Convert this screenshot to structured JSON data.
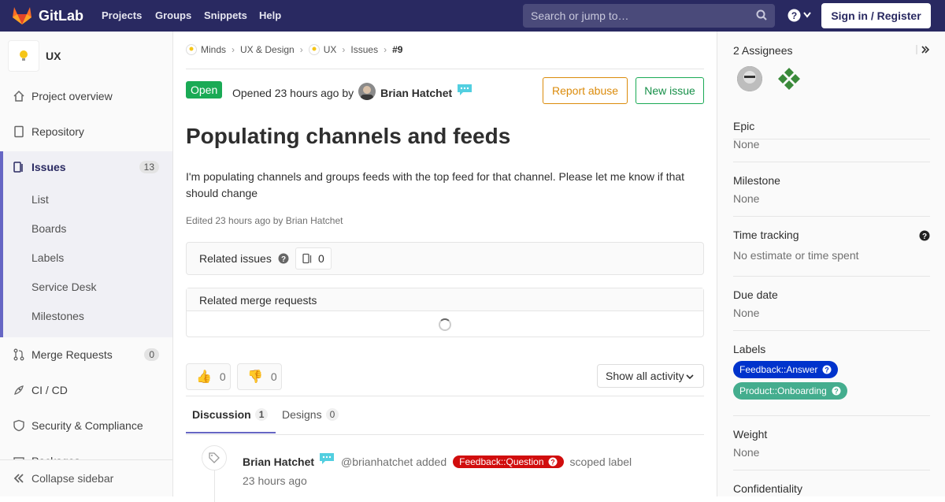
{
  "topbar": {
    "brand": "GitLab",
    "nav": [
      "Projects",
      "Groups",
      "Snippets",
      "Help"
    ],
    "search_placeholder": "Search or jump to…",
    "signin": "Sign in / Register"
  },
  "sidebar": {
    "project_name": "UX",
    "items": [
      {
        "label": "Project overview",
        "icon": "home-icon"
      },
      {
        "label": "Repository",
        "icon": "doc-icon"
      },
      {
        "label": "Issues",
        "icon": "issues-icon",
        "count": "13"
      },
      {
        "label": "Merge Requests",
        "icon": "merge-request-icon",
        "count": "0"
      },
      {
        "label": "CI / CD",
        "icon": "rocket-icon"
      },
      {
        "label": "Security & Compliance",
        "icon": "shield-icon"
      },
      {
        "label": "Packages",
        "icon": "package-icon"
      }
    ],
    "sub_items": [
      "List",
      "Boards",
      "Labels",
      "Service Desk",
      "Milestones"
    ],
    "collapse": "Collapse sidebar"
  },
  "breadcrumbs": [
    "Minds",
    "UX & Design",
    "UX",
    "Issues",
    "#9"
  ],
  "issue": {
    "status": "Open",
    "opened_text": "Opened 23 hours ago by",
    "author": "Brian Hatchet",
    "report_abuse": "Report abuse",
    "new_issue": "New issue",
    "title": "Populating channels and feeds",
    "description": "I'm populating channels and groups feeds with the top feed for that channel. Please let me know if that should change",
    "edited": "Edited 23 hours ago by Brian Hatchet",
    "related_issues": "Related issues",
    "related_count": "0",
    "related_mrs": "Related merge requests",
    "thumbs_up": "0",
    "thumbs_down": "0",
    "activity_filter": "Show all activity"
  },
  "tabs": [
    {
      "label": "Discussion",
      "count": "1"
    },
    {
      "label": "Designs",
      "count": "0"
    }
  ],
  "note": {
    "author": "Brian Hatchet",
    "action": "@brianhatchet added",
    "label": "Feedback::Question",
    "suffix": "scoped label",
    "time": "23 hours ago"
  },
  "right_sidebar": {
    "assignees_title": "2 Assignees",
    "epic_title": "Epic",
    "epic_value": "None",
    "milestone_title": "Milestone",
    "milestone_value": "None",
    "time_title": "Time tracking",
    "time_value": "No estimate or time spent",
    "due_title": "Due date",
    "due_value": "None",
    "labels_title": "Labels",
    "labels": [
      {
        "text": "Feedback::Answer",
        "color": "#0033cc"
      },
      {
        "text": "Product::Onboarding",
        "color": "#44ad8e"
      }
    ],
    "weight_title": "Weight",
    "weight_value": "None",
    "confidentiality_title": "Confidentiality"
  },
  "colors": {
    "topbar": "#292961",
    "open": "#1aaa55",
    "abuse": "#db8b0b",
    "scoped_red": "#d10d0d"
  }
}
